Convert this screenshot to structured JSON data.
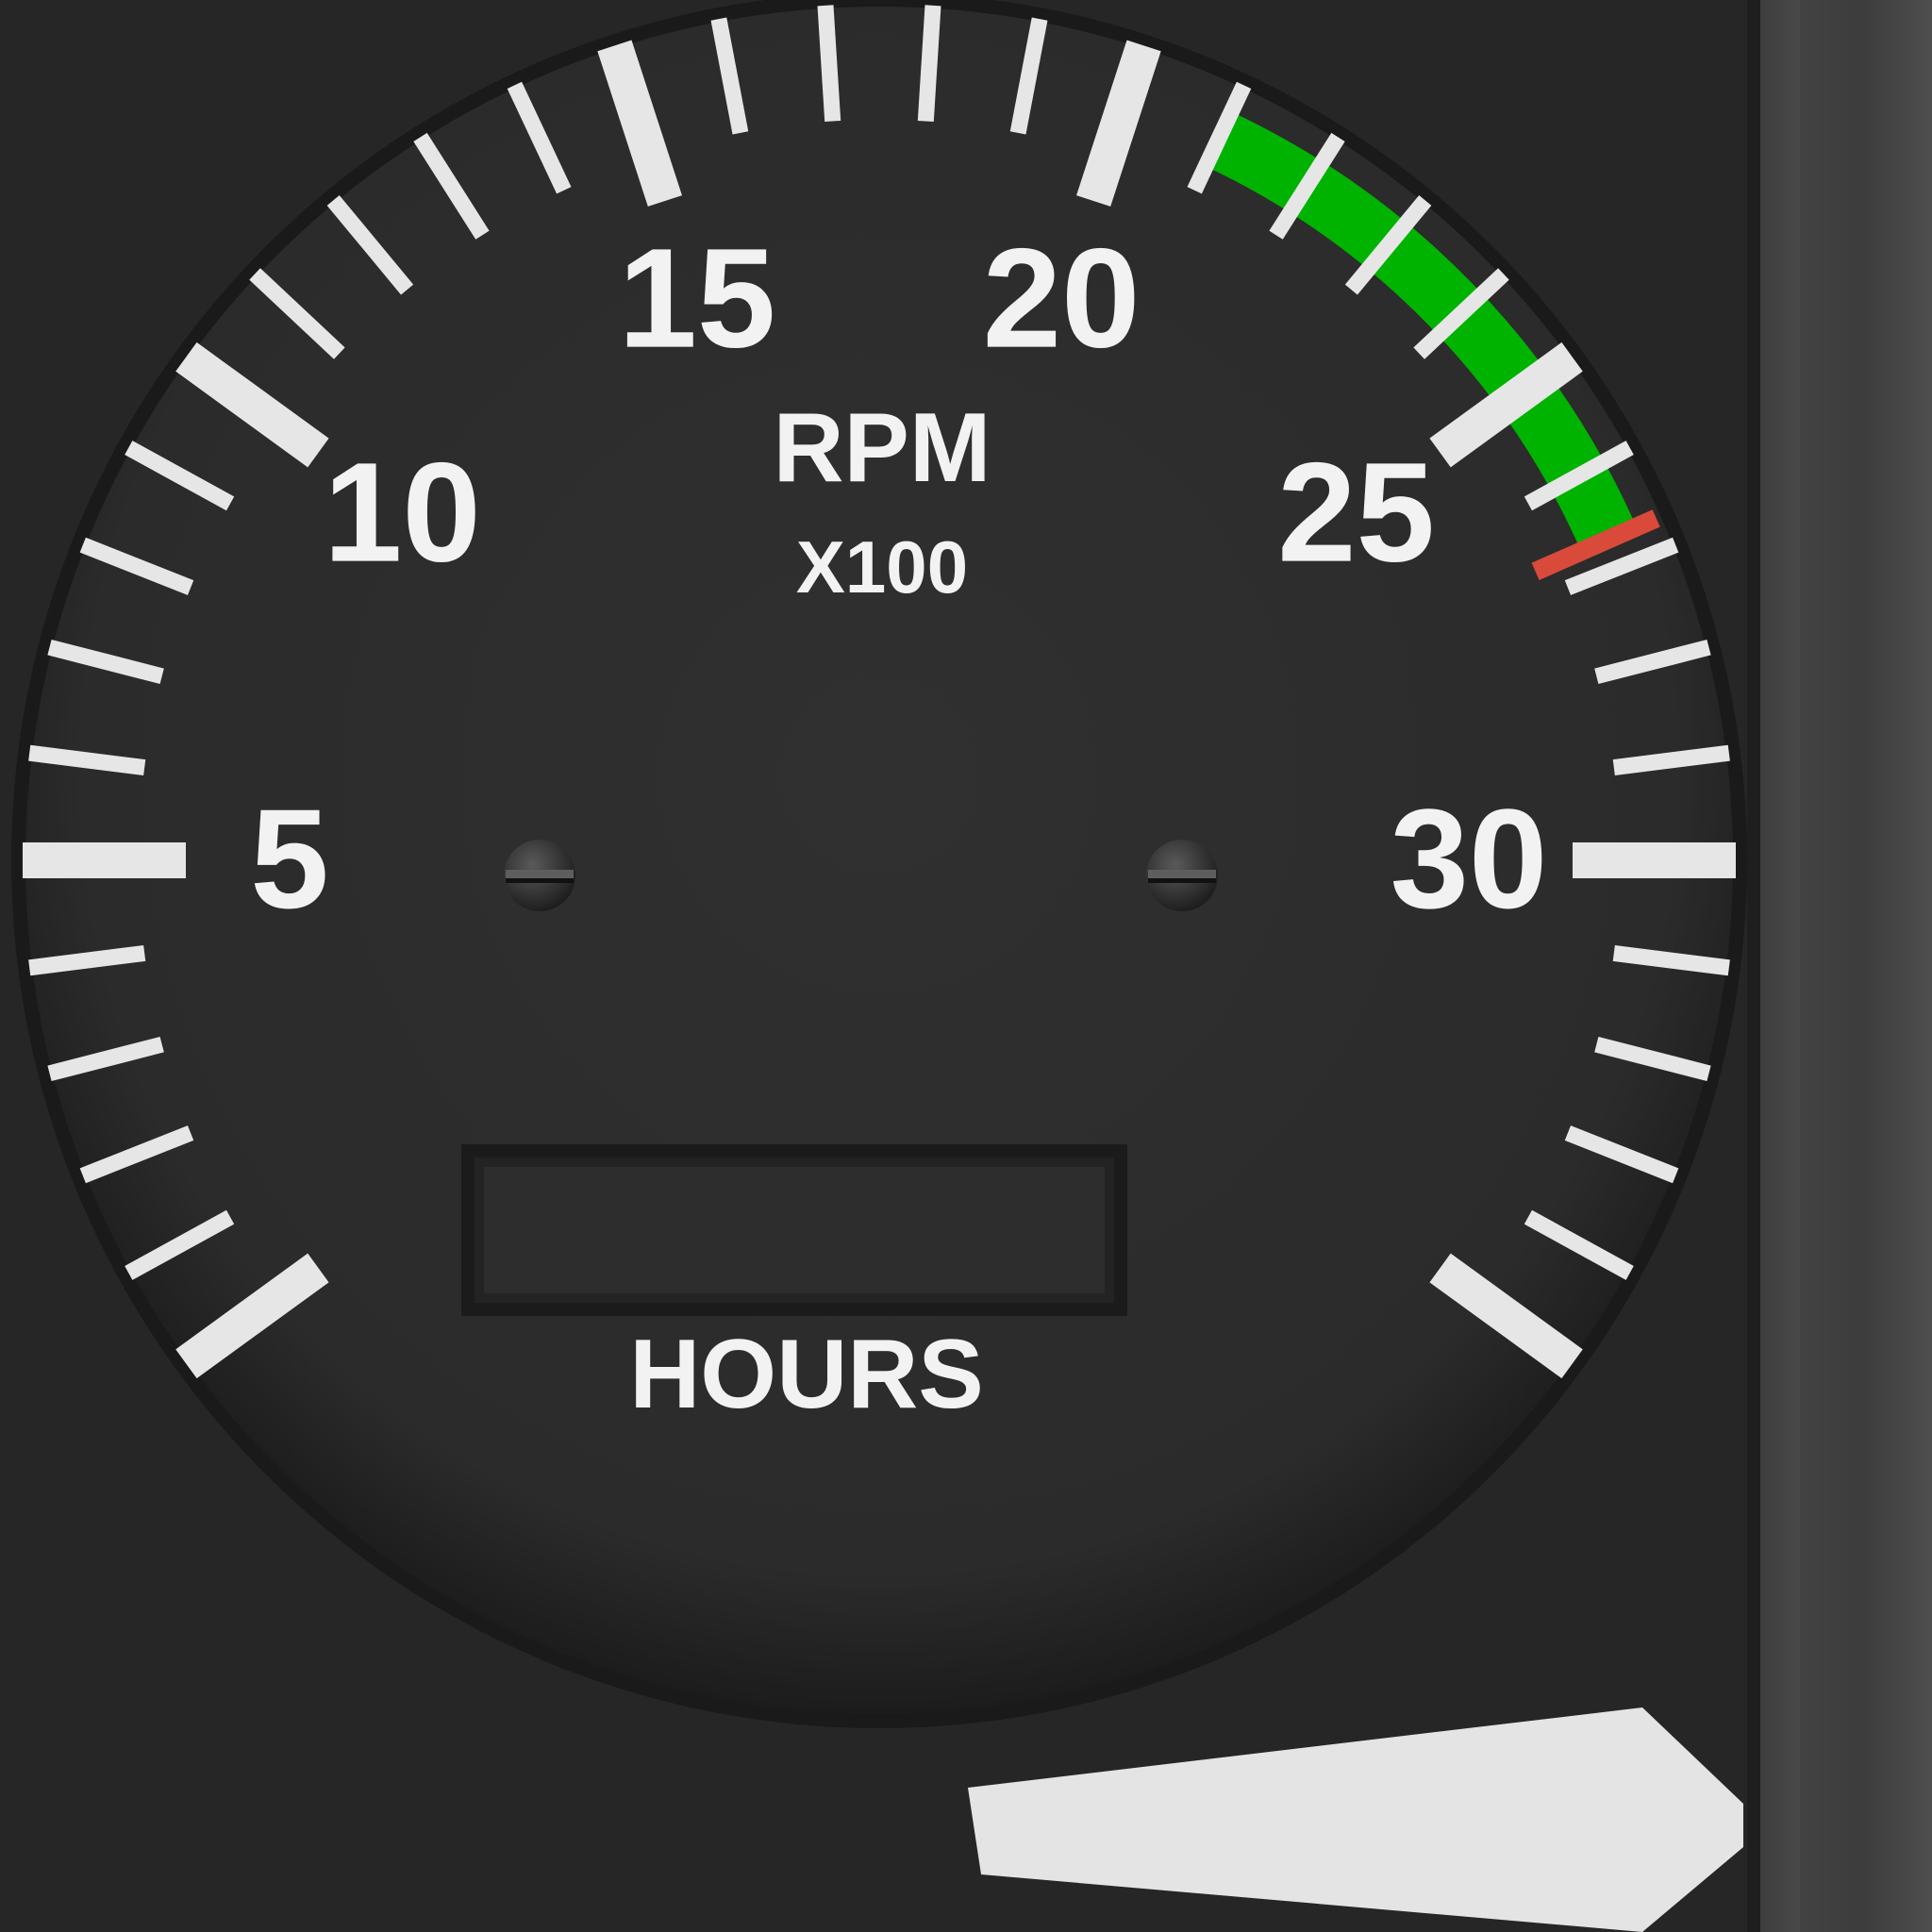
{
  "gauge": {
    "scale_min": 0,
    "scale_max": 35,
    "labels": [
      {
        "value": 5,
        "text": "5"
      },
      {
        "value": 10,
        "text": "10"
      },
      {
        "value": 15,
        "text": "15"
      },
      {
        "value": 20,
        "text": "20"
      },
      {
        "value": 25,
        "text": "25"
      },
      {
        "value": 30,
        "text": "30"
      }
    ],
    "units_line1": "RPM",
    "units_line2": "X100",
    "hours_label": "HOURS",
    "hours_value": "",
    "green_arc": {
      "from": 21,
      "to": 26.7,
      "color": "#00b300"
    },
    "redline": {
      "value": 26.7,
      "color": "#d94a3a"
    },
    "needle_value": 35.2,
    "needle_color": "#e4e4e4"
  }
}
